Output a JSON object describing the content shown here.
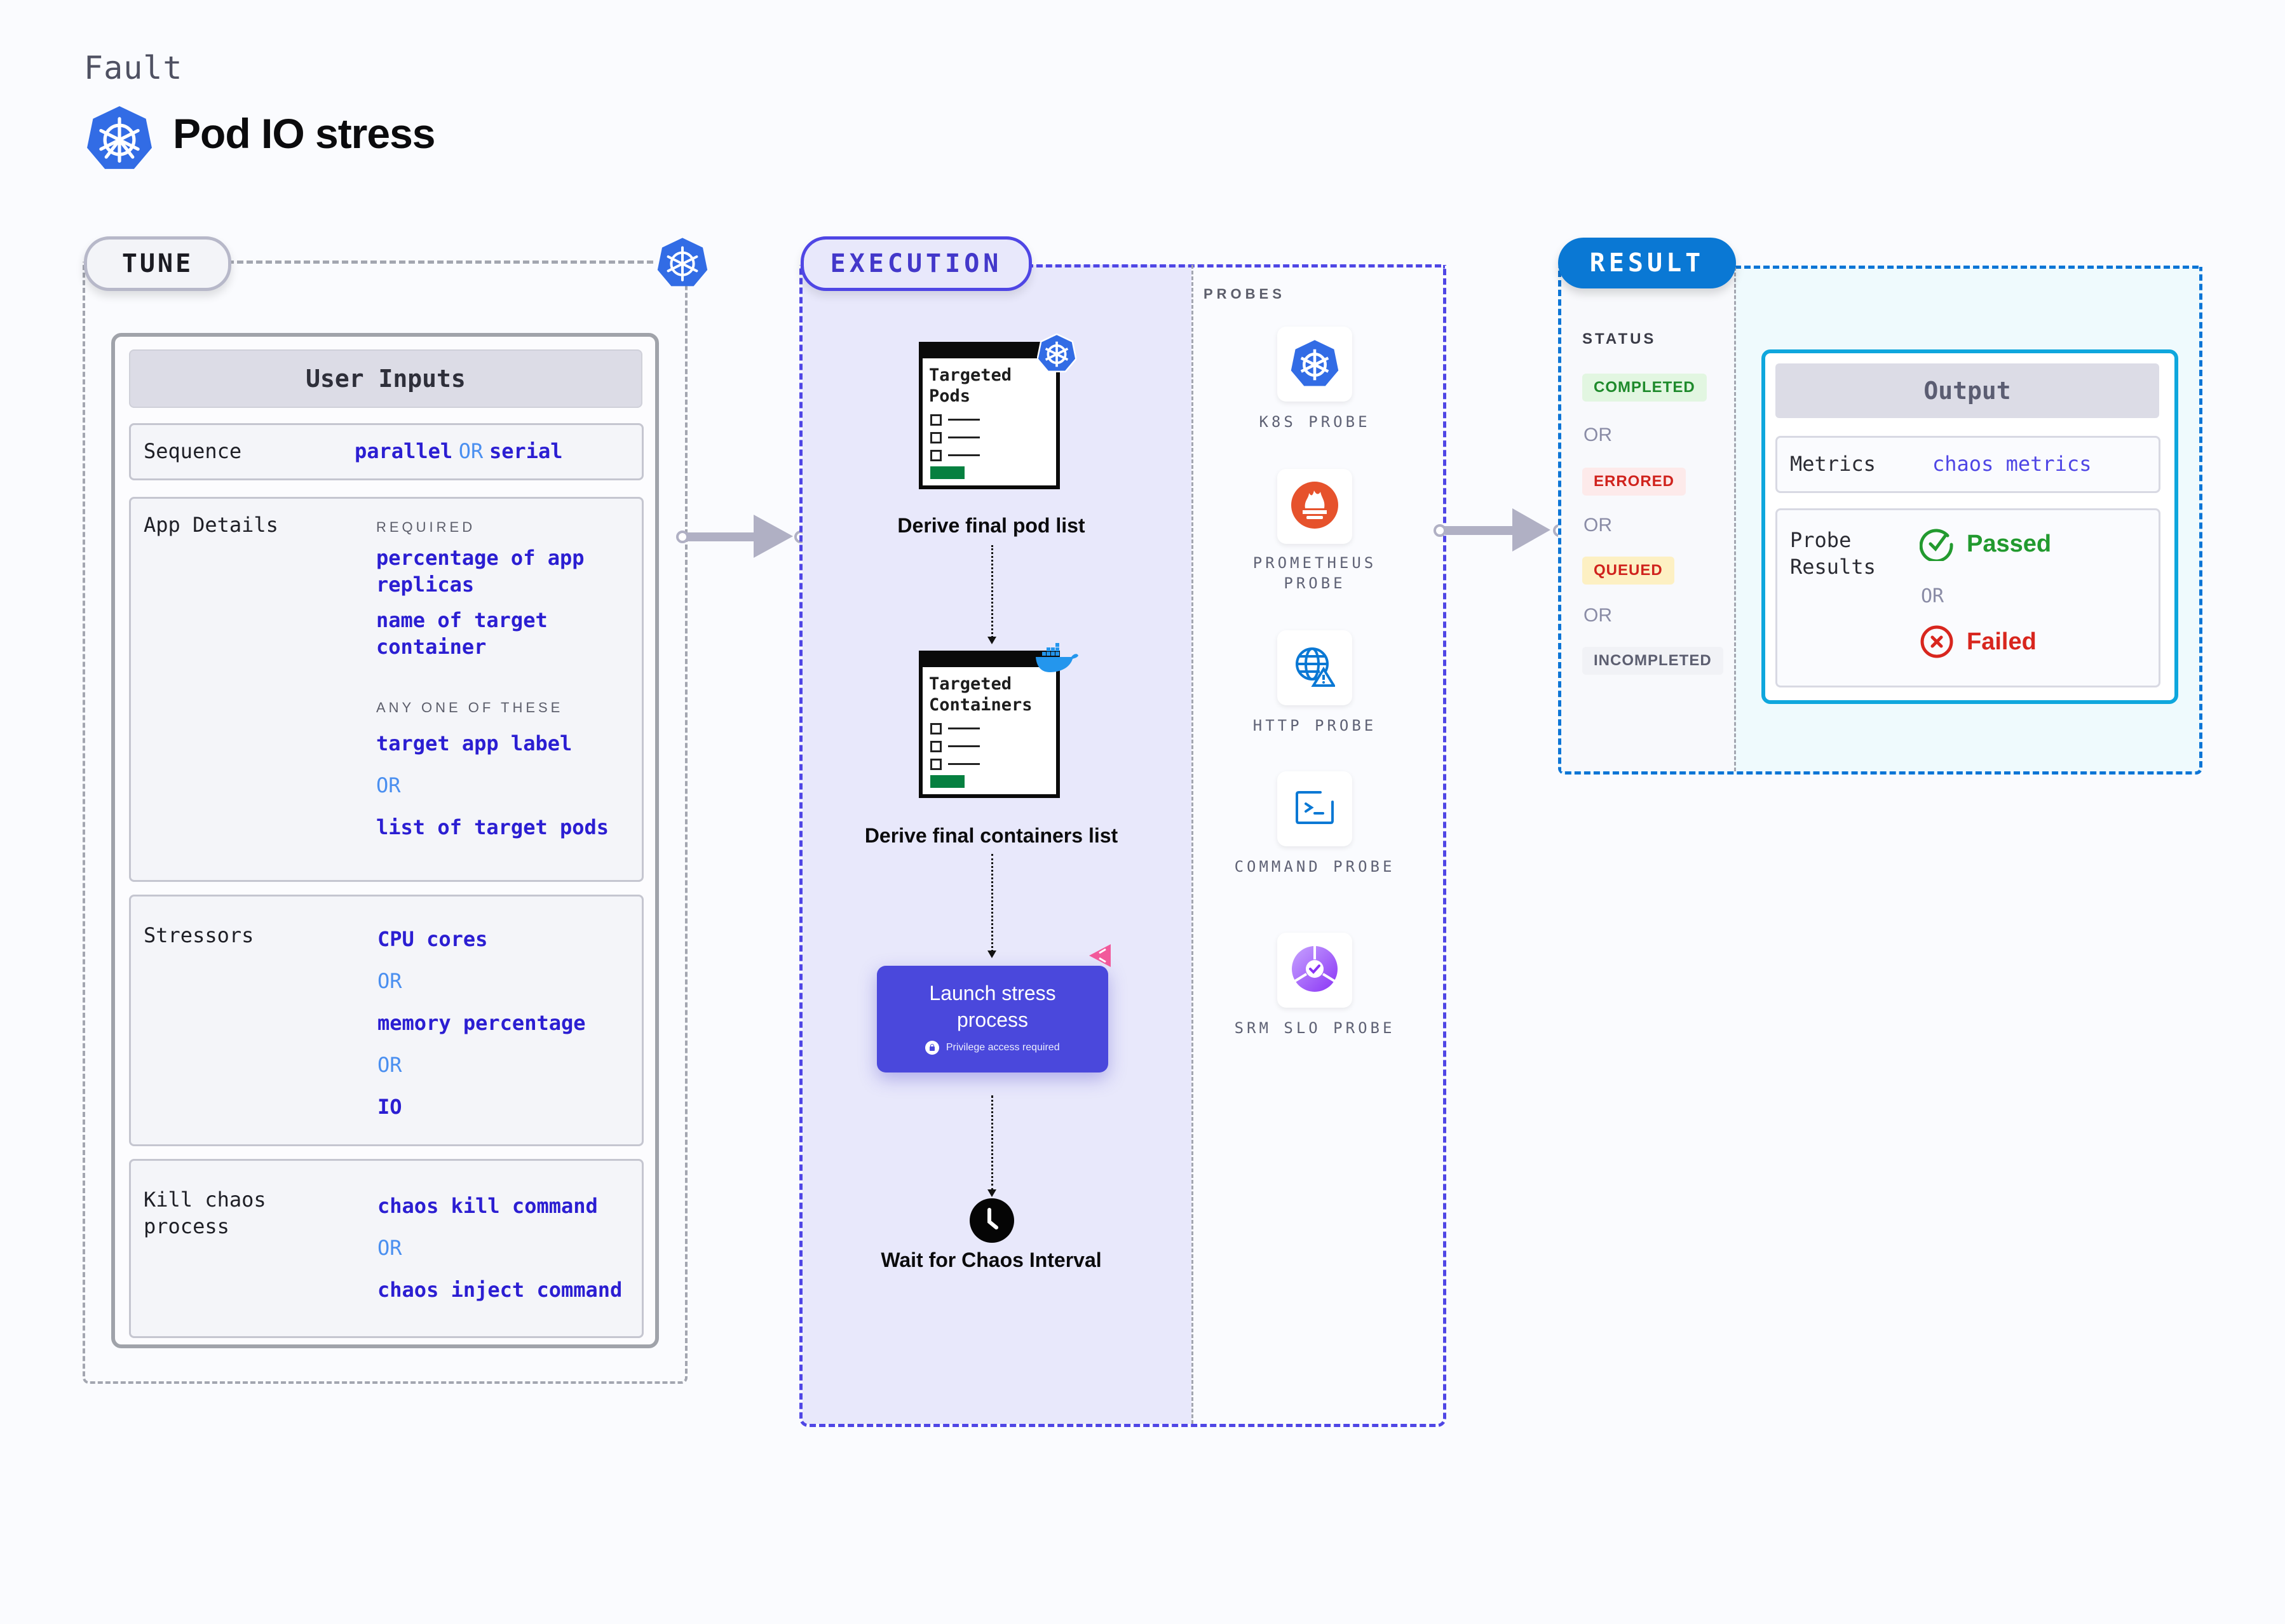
{
  "header": {
    "category": "Fault",
    "title": "Pod IO stress",
    "icon": "kubernetes-icon"
  },
  "colors": {
    "tune_border": "#a3a6b0",
    "execution_accent": "#4f46e5",
    "result_accent": "#0a78d4",
    "value_text": "#2b1ed2",
    "or_text": "#4a8ff0"
  },
  "tune": {
    "label": "TUNE",
    "corner_icon": "kubernetes-icon",
    "user_inputs": {
      "title": "User Inputs",
      "sequence": {
        "label": "Sequence",
        "value_a": "parallel",
        "or": "OR",
        "value_b": "serial"
      },
      "app_details": {
        "label": "App Details",
        "required_caption": "REQUIRED",
        "required": [
          "percentage of app replicas",
          "name of target container"
        ],
        "any_caption": "ANY ONE OF THESE",
        "any_of": [
          "target app label",
          "list of target pods"
        ],
        "or": "OR"
      },
      "stressors": {
        "label": "Stressors",
        "options": [
          "CPU cores",
          "memory percentage",
          "IO"
        ],
        "or": "OR"
      },
      "kill_chaos": {
        "label": "Kill chaos process",
        "options": [
          "chaos kill command",
          "chaos inject command"
        ],
        "or": "OR"
      }
    }
  },
  "execution": {
    "label": "EXECUTION",
    "steps": [
      {
        "card_title": "Targeted Pods",
        "badge_icon": "kubernetes-icon",
        "label": "Derive final pod list"
      },
      {
        "card_title": "Targeted Containers",
        "badge_icon": "docker-icon",
        "label": "Derive final containers list"
      },
      {
        "label": "Launch stress process",
        "sublabel": "Privilege access required",
        "badge_icon": "chaos-icon"
      },
      {
        "label": "Wait for Chaos Interval",
        "icon": "clock-icon"
      }
    ],
    "probes": {
      "title": "PROBES",
      "items": [
        {
          "label": "K8S PROBE",
          "icon": "kubernetes-icon"
        },
        {
          "label": "PROMETHEUS PROBE",
          "icon": "prometheus-icon"
        },
        {
          "label": "HTTP PROBE",
          "icon": "http-globe-icon"
        },
        {
          "label": "COMMAND PROBE",
          "icon": "terminal-icon"
        },
        {
          "label": "SRM SLO PROBE",
          "icon": "slo-icon"
        }
      ]
    }
  },
  "result": {
    "label": "RESULT",
    "status": {
      "title": "STATUS",
      "or": "OR",
      "badges": [
        {
          "label": "COMPLETED",
          "fg": "#1e8a2b",
          "bg": "#e2f6e1"
        },
        {
          "label": "ERRORED",
          "fg": "#d0231d",
          "bg": "#fdeaea"
        },
        {
          "label": "QUEUED",
          "fg": "#d0231d",
          "bg": "#fdf0c3"
        },
        {
          "label": "INCOMPLETED",
          "fg": "#5c5e70",
          "bg": "#f1f2f6"
        }
      ]
    },
    "output": {
      "title": "Output",
      "metrics_label": "Metrics",
      "metrics_value": "chaos metrics",
      "probe_results_label": "Probe Results",
      "passed": "Passed",
      "or": "OR",
      "failed": "Failed"
    }
  }
}
